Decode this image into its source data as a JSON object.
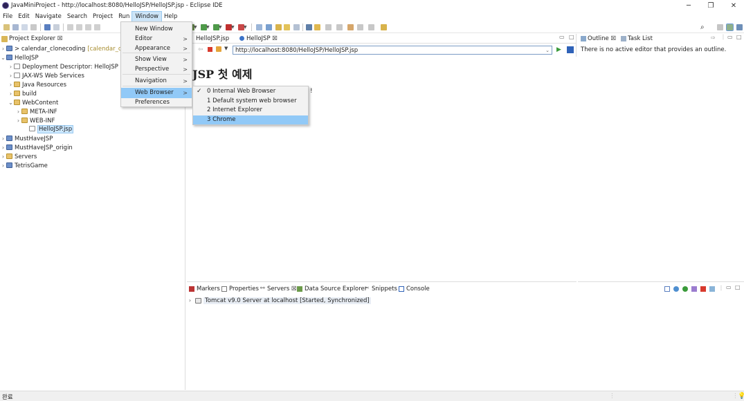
{
  "window": {
    "title": "JavaMiniProject - http://localhost:8080/HelloJSP/HelloJSP.jsp - Eclipse IDE",
    "minimize_glyph": "─",
    "maximize_glyph": "❐",
    "close_glyph": "✕"
  },
  "menubar": {
    "items": [
      "File",
      "Edit",
      "Navigate",
      "Search",
      "Project",
      "Run",
      "Window",
      "Help"
    ],
    "active": "Window"
  },
  "window_menu": {
    "items": [
      {
        "label": "New Window",
        "has_submenu": false
      },
      {
        "label": "Editor",
        "has_submenu": true
      },
      {
        "label": "Appearance",
        "has_submenu": true
      },
      {
        "label": "Show View",
        "has_submenu": true
      },
      {
        "label": "Perspective",
        "has_submenu": true
      },
      {
        "label": "Navigation",
        "has_submenu": true
      },
      {
        "label": "Web Browser",
        "has_submenu": true
      },
      {
        "label": "Preferences",
        "has_submenu": false
      }
    ],
    "highlighted": "Web Browser",
    "submenu_glyph": ">"
  },
  "web_browser_submenu": {
    "items": [
      {
        "label": "0 Internal Web Browser",
        "checked": true
      },
      {
        "label": "1 Default system web browser",
        "checked": false
      },
      {
        "label": "2 Internet Explorer",
        "checked": false
      },
      {
        "label": "3 Chrome",
        "checked": false
      }
    ],
    "highlighted": "3 Chrome",
    "check_glyph": "✓"
  },
  "project_explorer": {
    "tab_label": "Project Explorer ☒",
    "items": [
      {
        "twist": "›",
        "label": "> calendar_clonecoding",
        "suffix": "[calendar_clon",
        "icon": "proj"
      },
      {
        "twist": "⌄",
        "label": "HelloJSP",
        "suffix": "",
        "icon": "proj"
      },
      {
        "twist": "›",
        "label": "Deployment Descriptor: HelloJSP",
        "suffix": "",
        "icon": "file"
      },
      {
        "twist": "›",
        "label": "JAX-WS Web Services",
        "suffix": "",
        "icon": "file"
      },
      {
        "twist": "›",
        "label": "Java Resources",
        "suffix": "",
        "icon": "folder"
      },
      {
        "twist": "›",
        "label": "build",
        "suffix": "",
        "icon": "folder"
      },
      {
        "twist": "⌄",
        "label": "WebContent",
        "suffix": "",
        "icon": "folder"
      },
      {
        "twist": "›",
        "label": "META-INF",
        "suffix": "",
        "icon": "folder"
      },
      {
        "twist": "›",
        "label": "WEB-INF",
        "suffix": "",
        "icon": "folder"
      },
      {
        "twist": "",
        "label": "HelloJSP.jsp",
        "suffix": "",
        "icon": "file",
        "selected": true
      },
      {
        "twist": "›",
        "label": "MustHaveJSP",
        "suffix": "",
        "icon": "proj"
      },
      {
        "twist": "›",
        "label": "MustHaveJSP_origin",
        "suffix": "",
        "icon": "proj"
      },
      {
        "twist": "›",
        "label": "Servers",
        "suffix": "",
        "icon": "folder"
      },
      {
        "twist": "›",
        "label": "TetrisGame",
        "suffix": "",
        "icon": "proj"
      }
    ]
  },
  "editor": {
    "tabs": [
      {
        "label": "HelloJSP.jsp",
        "active": false
      },
      {
        "label": "HelloJSP ☒",
        "active": true
      }
    ],
    "url": "http://localhost:8080/HelloJSP/HelloJSP.jsp",
    "heading": "JSP 첫 예제",
    "partial_text": "!"
  },
  "outline": {
    "tab_outline": "Outline ☒",
    "tab_tasklist": "Task List",
    "message": "There is no active editor that provides an outline."
  },
  "servers_panel": {
    "tabs": [
      "Markers",
      "Properties",
      "Servers ☒",
      "Data Source Explorer",
      "Snippets",
      "Console"
    ],
    "server_name": "Tomcat v9.0 Server at localhost",
    "server_status": "[Started, Synchronized]"
  },
  "statusbar": {
    "text": "완료"
  },
  "colors": {
    "menu_highlight": "#91c9f7",
    "active_menu": "#cce4f7",
    "selection": "#cde8ff"
  }
}
